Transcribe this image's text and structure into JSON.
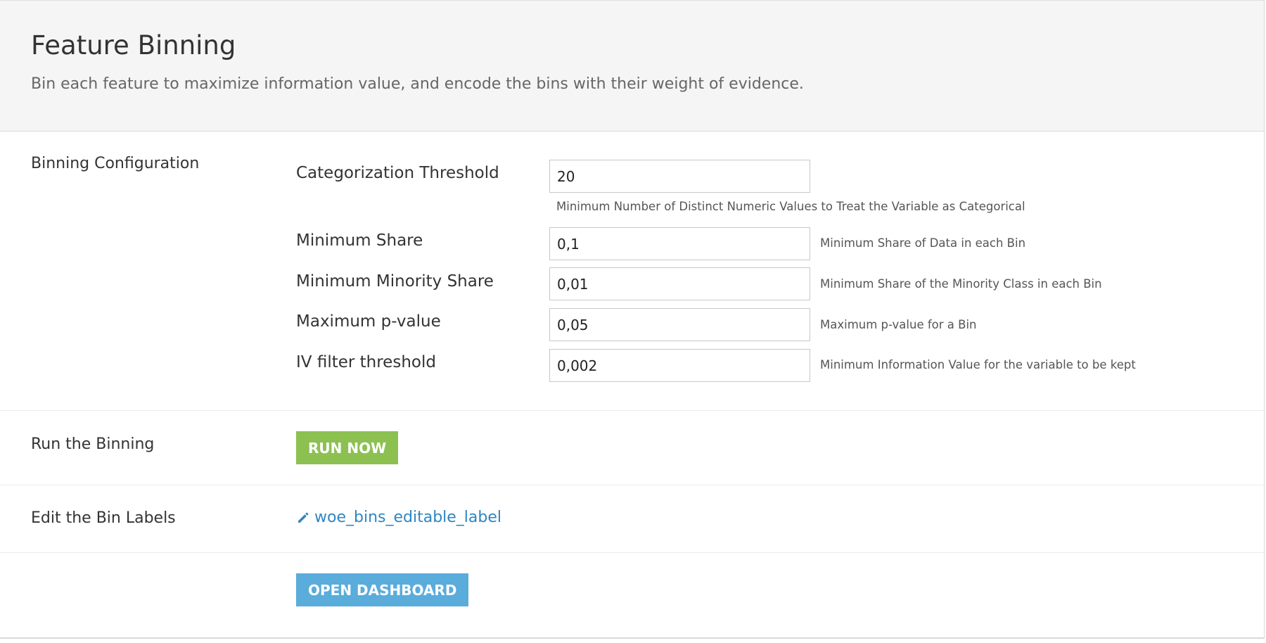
{
  "header": {
    "title": "Feature Binning",
    "subtitle": "Bin each feature to maximize information value, and encode the bins with their weight of evidence."
  },
  "binning_config": {
    "section_label": "Binning Configuration",
    "fields": [
      {
        "label": "Categorization Threshold",
        "value": "20",
        "help": "Minimum Number of Distinct Numeric Values to Treat the Variable as Categorical"
      },
      {
        "label": "Minimum Share",
        "value": "0,1",
        "help": "Minimum Share of Data in each Bin"
      },
      {
        "label": "Minimum Minority Share",
        "value": "0,01",
        "help": "Minimum Share of the Minority Class in each Bin"
      },
      {
        "label": "Maximum p-value",
        "value": "0,05",
        "help": "Maximum p-value for a Bin"
      },
      {
        "label": "IV filter threshold",
        "value": "0,002",
        "help": "Minimum Information Value for the variable to be kept"
      }
    ]
  },
  "run": {
    "section_label": "Run the Binning",
    "button_label": "RUN NOW",
    "color": "#8cc152"
  },
  "edit_labels": {
    "section_label": "Edit the Bin Labels",
    "link_label": "woe_bins_editable_label",
    "icon": "pencil-icon",
    "color": "#2e86c1"
  },
  "dashboard": {
    "button_label": "OPEN DASHBOARD",
    "color": "#5aacdb"
  }
}
